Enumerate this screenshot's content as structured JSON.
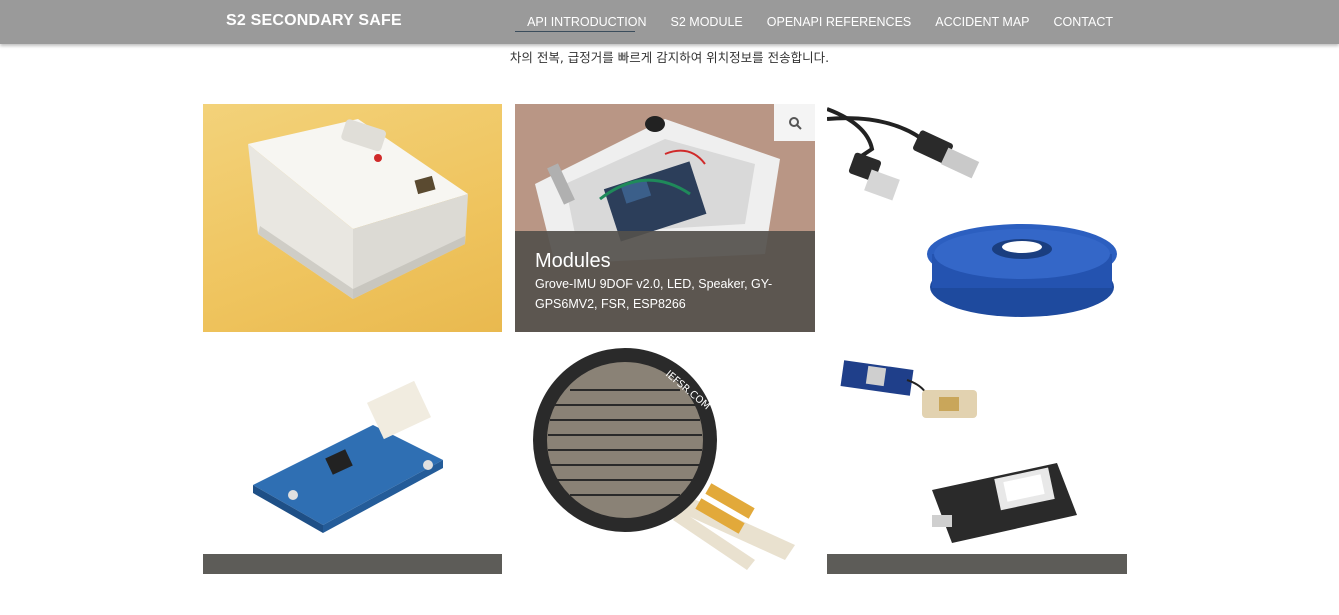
{
  "brand": "S2 SECONDARY SAFE",
  "nav": {
    "items": [
      "API INTRODUCTION",
      "S2 MODULE",
      "OPENAPI REFERENCES",
      "ACCIDENT MAP",
      "CONTACT"
    ]
  },
  "tagline": "차의 전복, 급정거를 빠르게 감지하여 위치정보를 전송합니다.",
  "portfolio": {
    "hover_item": {
      "title": "Modules",
      "description": "Grove-IMU 9DOF v2.0, LED, Speaker, GY-GPS6MV2, FSR, ESP8266"
    },
    "fsr_print": "IEFSR.COM"
  },
  "colors": {
    "navbar": "#9a9a9a",
    "overlay": "#54504c",
    "caption_bar": "#5d5c58"
  },
  "icons": [
    "search-icon"
  ]
}
